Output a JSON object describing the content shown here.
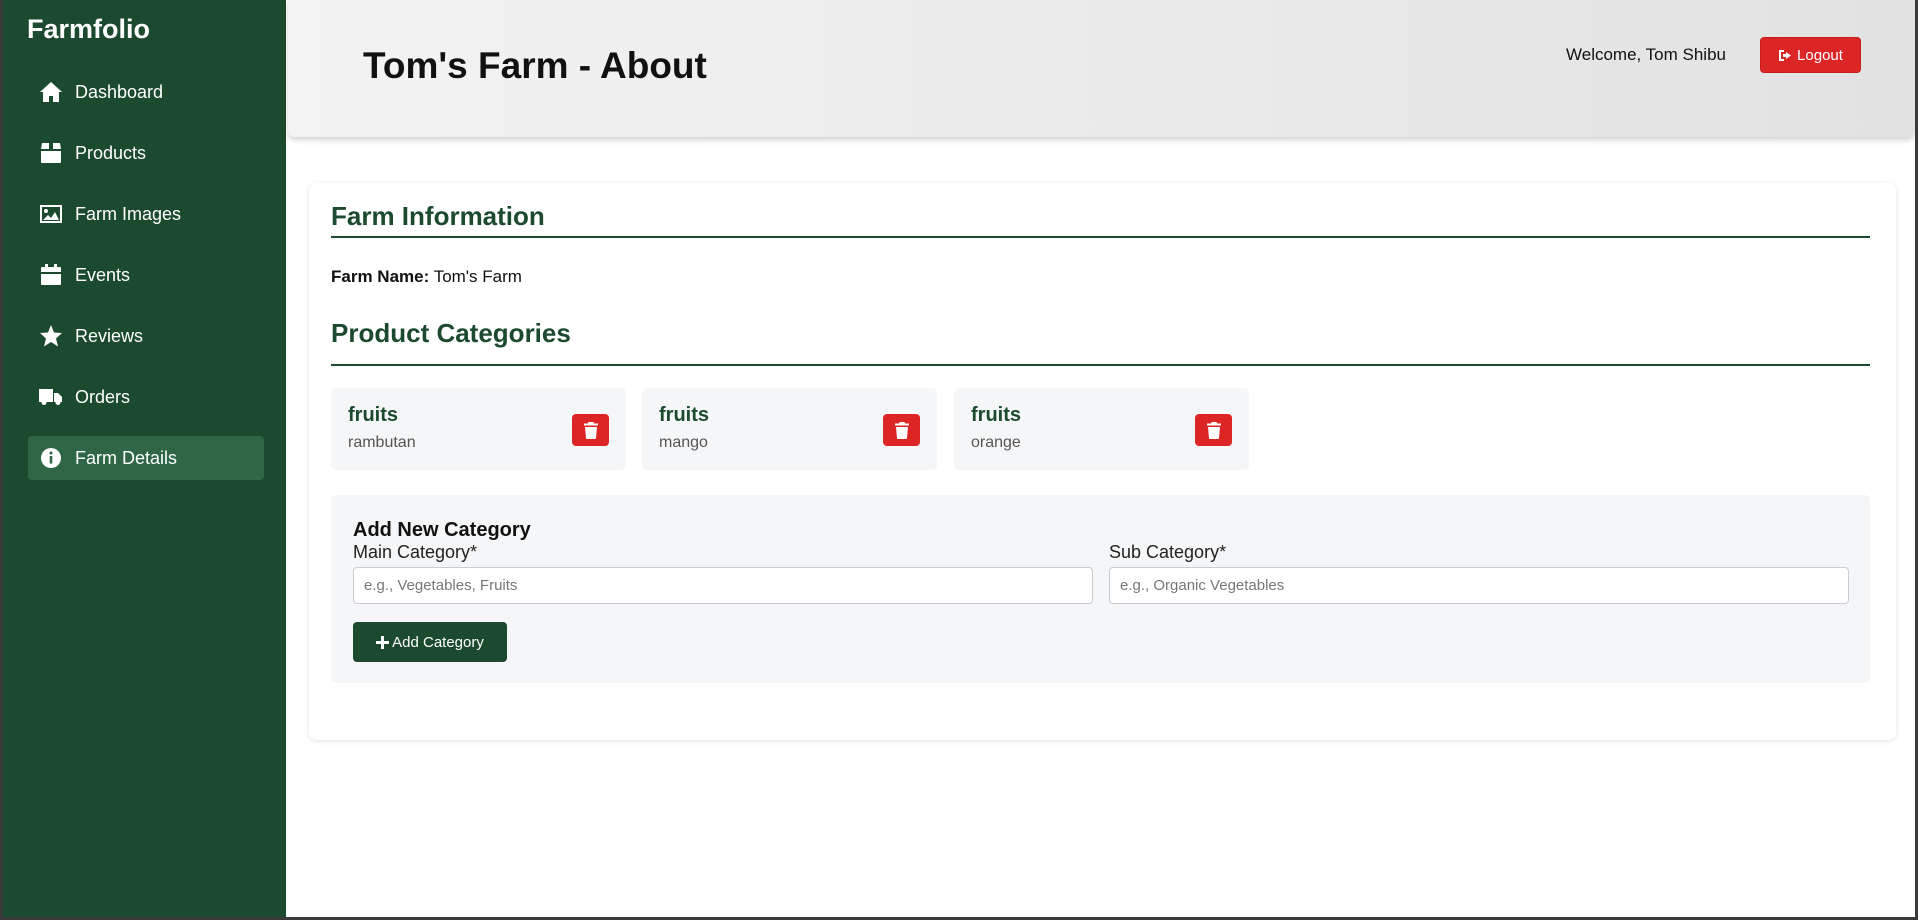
{
  "app": {
    "brand": "Farmfolio"
  },
  "sidebar": {
    "items": [
      {
        "label": "Dashboard",
        "icon": "home-icon"
      },
      {
        "label": "Products",
        "icon": "box-icon"
      },
      {
        "label": "Farm Images",
        "icon": "image-icon"
      },
      {
        "label": "Events",
        "icon": "calendar-icon"
      },
      {
        "label": "Reviews",
        "icon": "star-icon"
      },
      {
        "label": "Orders",
        "icon": "truck-icon"
      },
      {
        "label": "Farm Details",
        "icon": "info-icon",
        "active": true
      }
    ]
  },
  "header": {
    "title": "Tom's Farm - About",
    "welcome": "Welcome, Tom Shibu",
    "logout_label": "Logout"
  },
  "farm_info": {
    "heading": "Farm Information",
    "name_label": "Farm Name:",
    "name_value": "Tom's Farm"
  },
  "categories": {
    "heading": "Product Categories",
    "items": [
      {
        "main": "fruits",
        "sub": "rambutan"
      },
      {
        "main": "fruits",
        "sub": "mango"
      },
      {
        "main": "fruits",
        "sub": "orange"
      }
    ]
  },
  "add_category": {
    "title": "Add New Category",
    "main_label": "Main Category*",
    "main_placeholder": "e.g., Vegetables, Fruits",
    "sub_label": "Sub Category*",
    "sub_placeholder": "e.g., Organic Vegetables",
    "button_label": "Add Category"
  },
  "colors": {
    "sidebar_bg": "#1c4a2e",
    "accent_green": "#1c4a2e",
    "danger_red": "#dc2626"
  }
}
